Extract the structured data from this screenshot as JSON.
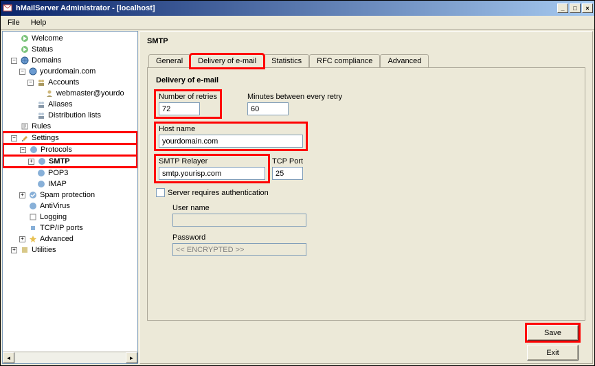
{
  "window": {
    "title": "hMailServer Administrator - [localhost]"
  },
  "menubar": {
    "file": "File",
    "help": "Help"
  },
  "tree": {
    "welcome": "Welcome",
    "status": "Status",
    "domains": "Domains",
    "yourdomain": "yourdomain.com",
    "accounts": "Accounts",
    "webmaster": "webmaster@yourdo",
    "aliases": "Aliases",
    "distlists": "Distribution lists",
    "rules": "Rules",
    "settings": "Settings",
    "protocols": "Protocols",
    "smtp": "SMTP",
    "pop3": "POP3",
    "imap": "IMAP",
    "spam": "Spam protection",
    "antivirus": "AntiVirus",
    "logging": "Logging",
    "tcpip": "TCP/IP ports",
    "advanced": "Advanced",
    "utilities": "Utilities"
  },
  "panel": {
    "title": "SMTP"
  },
  "tabs": {
    "general": "General",
    "delivery": "Delivery of e-mail",
    "statistics": "Statistics",
    "rfc": "RFC compliance",
    "advanced": "Advanced"
  },
  "form": {
    "section_title": "Delivery of e-mail",
    "retries_label": "Number of retries",
    "retries_value": "72",
    "minutes_label": "Minutes between every retry",
    "minutes_value": "60",
    "hostname_label": "Host name",
    "hostname_value": "yourdomain.com",
    "relayer_label": "SMTP Relayer",
    "relayer_value": "smtp.yourisp.com",
    "tcpport_label": "TCP Port",
    "tcpport_value": "25",
    "auth_label": "Server requires authentication",
    "username_label": "User name",
    "username_value": "",
    "password_label": "Password",
    "password_value": "<< ENCRYPTED >>"
  },
  "buttons": {
    "save": "Save",
    "exit": "Exit"
  }
}
